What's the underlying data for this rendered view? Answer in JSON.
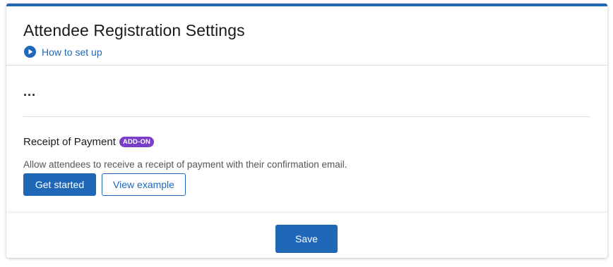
{
  "colors": {
    "accent": "#1f68b8",
    "badge": "#7a3fc8"
  },
  "header": {
    "title": "Attendee Registration Settings",
    "howto_icon": "play-circle-icon",
    "howto_label": "How to set up"
  },
  "body": {
    "ellipsis": "...",
    "section": {
      "title": "Receipt of Payment",
      "badge": "ADD-ON",
      "description": "Allow attendees to receive a receipt of payment with their confirmation email.",
      "primary_button": "Get started",
      "secondary_button": "View example"
    }
  },
  "footer": {
    "save_label": "Save"
  }
}
